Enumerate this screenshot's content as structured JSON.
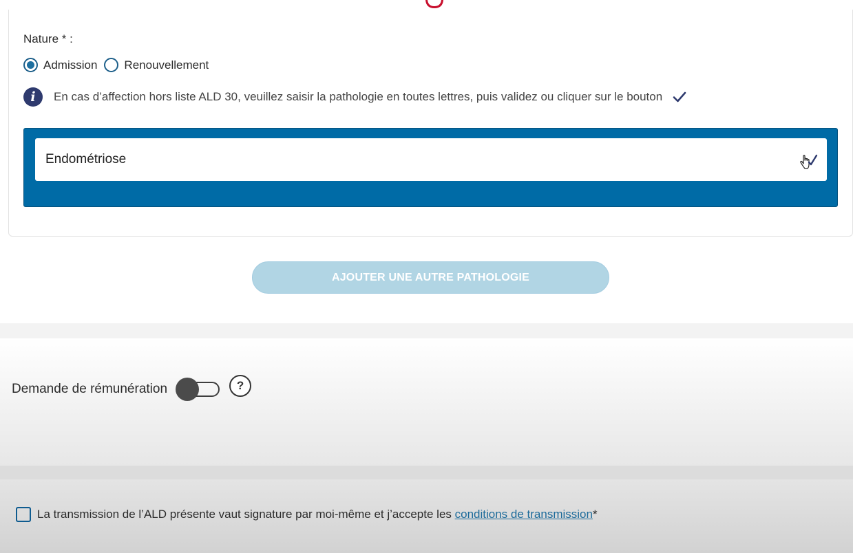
{
  "form": {
    "nature_label": "Nature * :",
    "radio_options": [
      {
        "label": "Admission",
        "selected": true
      },
      {
        "label": "Renouvellement",
        "selected": false
      }
    ],
    "info_text": "En cas d’affection hors liste ALD 30, veuillez saisir la pathologie en toutes lettres, puis validez ou cliquer sur le bouton",
    "pathology_input_value": "Endométriose",
    "add_pathology_label": "AJOUTER UNE AUTRE PATHOLOGIE"
  },
  "remuneration": {
    "label": "Demande de rémunération",
    "toggle_on": false,
    "help_glyph": "?"
  },
  "consent": {
    "text_before": "La transmission de l’ALD présente vaut signature par moi-même et j’accepte les ",
    "link_text": "conditions de transmission",
    "text_after": "*",
    "checked": false
  },
  "colors": {
    "accent_blue": "#006ba6",
    "radio_blue": "#1d6fa0",
    "info_icon_navy": "#2e3a6e",
    "disabled_button": "#b1d5e4",
    "link_blue": "#1b6a9a",
    "brand_red": "#c8102e"
  },
  "icons": {
    "info": "info-icon",
    "validate": "checkmark-icon",
    "help": "question-circle-icon"
  }
}
